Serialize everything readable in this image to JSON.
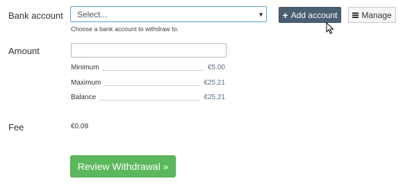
{
  "bank_account": {
    "label": "Bank account",
    "select_value": "Select...",
    "help_text": "Choose a bank account to withdraw to.",
    "add_button_label": "Add account",
    "manage_button_label": "Manage"
  },
  "amount": {
    "label": "Amount",
    "input_value": "",
    "limits": [
      {
        "label": "Minimum",
        "value": "€5.00"
      },
      {
        "label": "Maximum",
        "value": "€25.21"
      },
      {
        "label": "Balance",
        "value": "€25.21"
      }
    ]
  },
  "fee": {
    "label": "Fee",
    "value": "€0.09"
  },
  "submit": {
    "label": "Review Withdrawal »"
  },
  "icons": {
    "add": "plus-icon",
    "manage": "list-icon",
    "select": "caret-down-icon",
    "pointer": "mouse-cursor-icon"
  },
  "colors": {
    "primary_button": "#4a5f73",
    "success_button": "#5cb85c",
    "select_focus_border": "#5b9bd5",
    "limit_value": "#5a6b84"
  }
}
